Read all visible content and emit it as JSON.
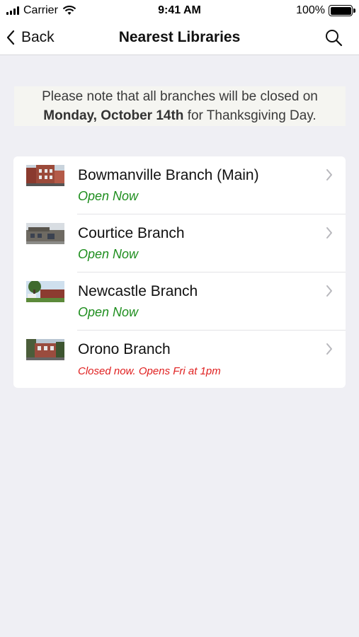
{
  "status_bar": {
    "carrier": "Carrier",
    "time": "9:41 AM",
    "battery": "100%"
  },
  "nav": {
    "back_label": "Back",
    "title": "Nearest Libraries",
    "search_icon": "search-icon"
  },
  "notice": {
    "prefix": "Please note that all branches will be closed on",
    "date": "Monday, October 14th",
    "suffix": "for Thanksgiving Day."
  },
  "branches": [
    {
      "name": "Bowmanville Branch (Main)",
      "status": "Open Now",
      "status_color": "#1e8e1e"
    },
    {
      "name": "Courtice Branch",
      "status": "Open Now",
      "status_color": "#1e8e1e"
    },
    {
      "name": "Newcastle Branch",
      "status": "Open Now",
      "status_color": "#1e8e1e"
    },
    {
      "name": "Orono Branch",
      "status": "Closed now. Opens Fri at 1pm",
      "status_color": "#e02020"
    }
  ],
  "colors": {
    "background": "#efeff4",
    "open": "#1e8e1e",
    "closed": "#e02020"
  }
}
